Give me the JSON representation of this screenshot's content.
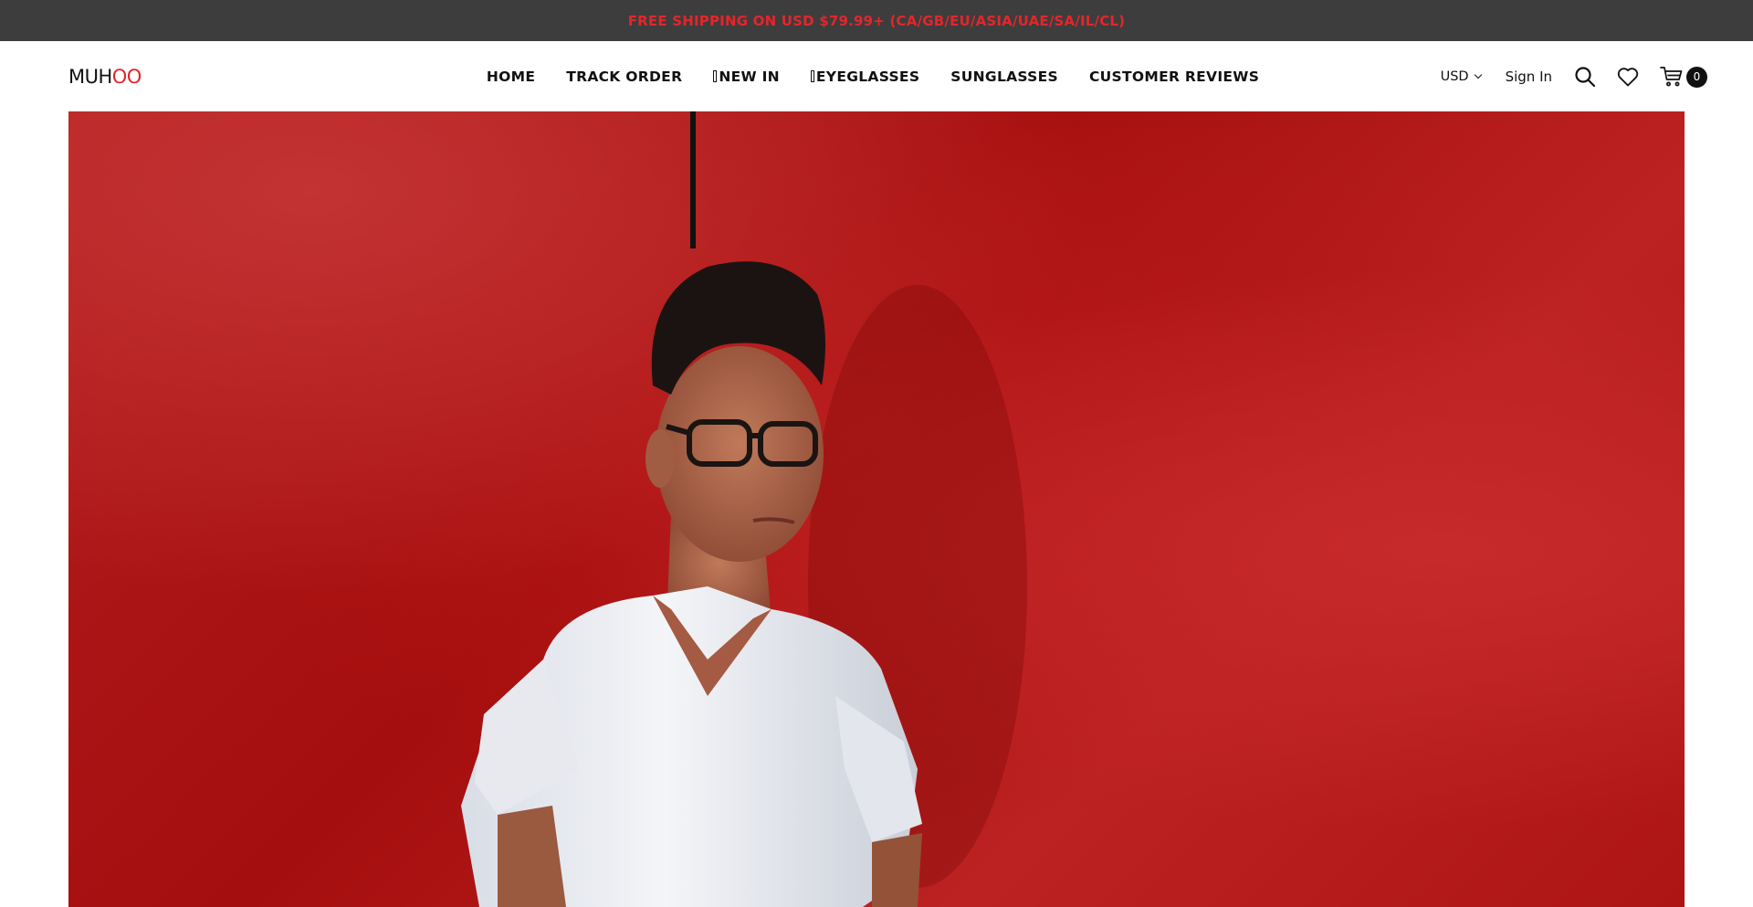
{
  "announcement": {
    "text": "FREE SHIPPING ON USD $79.99+ (CA/GB/EU/ASIA/UAE/SA/IL/CL)"
  },
  "brand": {
    "name_main": "MUH",
    "name_accent": "OO",
    "accent_color": "#e3262b"
  },
  "nav": {
    "items": [
      {
        "label": "HOME"
      },
      {
        "label": "TRACK ORDER"
      },
      {
        "label": "NEW IN"
      },
      {
        "label": "EYEGLASSES"
      },
      {
        "label": "SUNGLASSES"
      },
      {
        "label": "CUSTOMER REVIEWS"
      }
    ]
  },
  "header_tools": {
    "currency": "USD",
    "sign_in": "Sign In",
    "cart_count": "0",
    "icons": [
      "search-icon",
      "heart-icon",
      "cart-icon",
      "chevron-down-icon"
    ]
  },
  "hero": {
    "image": "man-in-glasses-red-wall-photo",
    "background_color": "#b51717"
  }
}
